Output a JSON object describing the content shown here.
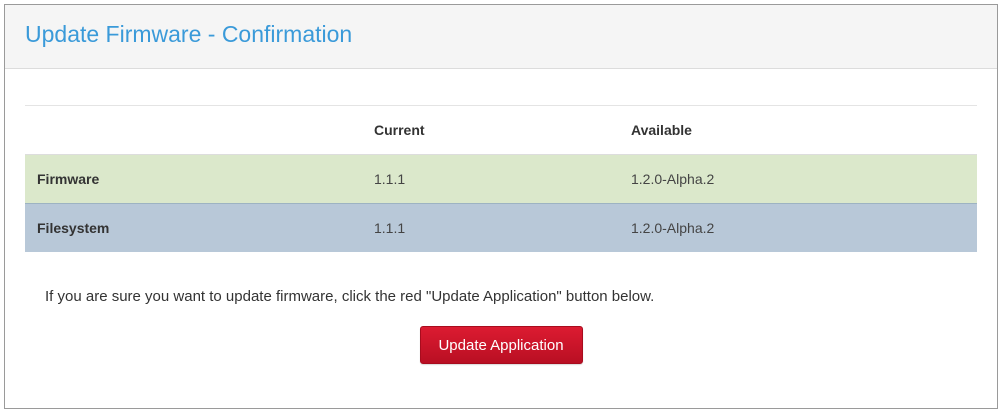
{
  "panel": {
    "title": "Update Firmware - Confirmation"
  },
  "table": {
    "columns": [
      "",
      "Current",
      "Available"
    ],
    "rows": [
      {
        "label": "Firmware",
        "current": "1.1.1",
        "available": "1.2.0-Alpha.2"
      },
      {
        "label": "Filesystem",
        "current": "1.1.1",
        "available": "1.2.0-Alpha.2"
      }
    ]
  },
  "message": "If you are sure you want to update firmware, click the red \"Update Application\" button below.",
  "actions": {
    "update_label": "Update Application"
  },
  "colors": {
    "title": "#3a9ad9",
    "firmware_row": "#dbe8cb",
    "filesystem_row": "#b8c8d8",
    "button": "#cc1428"
  }
}
